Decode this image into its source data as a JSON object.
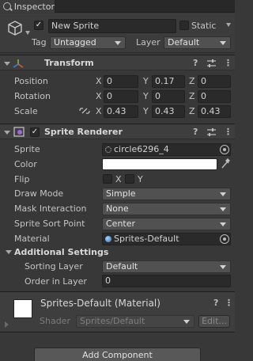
{
  "tab": {
    "label": "Inspector"
  },
  "object": {
    "active": true,
    "name": "New Sprite",
    "static_label": "Static",
    "tag_label": "Tag",
    "tag_value": "Untagged",
    "layer_label": "Layer",
    "layer_value": "Default"
  },
  "transform": {
    "title": "Transform",
    "position": {
      "label": "Position",
      "x": "0",
      "y": "0.17",
      "z": "0"
    },
    "rotation": {
      "label": "Rotation",
      "x": "0",
      "y": "0",
      "z": "0"
    },
    "scale": {
      "label": "Scale",
      "x": "0.43",
      "y": "0.43",
      "z": "0.43"
    },
    "axis_x": "X",
    "axis_y": "Y",
    "axis_z": "Z"
  },
  "sprite_renderer": {
    "title": "Sprite Renderer",
    "enabled": true,
    "sprite_label": "Sprite",
    "sprite_value": "circle6296_4",
    "color_label": "Color",
    "color_value": "#ffffff",
    "flip_label": "Flip",
    "flip_x": "X",
    "flip_y": "Y",
    "draw_mode_label": "Draw Mode",
    "draw_mode_value": "Simple",
    "mask_label": "Mask Interaction",
    "mask_value": "None",
    "sort_point_label": "Sprite Sort Point",
    "sort_point_value": "Center",
    "material_label": "Material",
    "material_value": "Sprites-Default",
    "additional_title": "Additional Settings",
    "sorting_layer_label": "Sorting Layer",
    "sorting_layer_value": "Default",
    "order_label": "Order in Layer",
    "order_value": "0"
  },
  "material": {
    "title": "Sprites-Default (Material)",
    "shader_label": "Shader",
    "shader_value": "Sprites/Default",
    "edit_label": "Edit..."
  },
  "footer": {
    "add_component": "Add Component"
  },
  "icons": {
    "help": "?",
    "more": "⋮"
  }
}
